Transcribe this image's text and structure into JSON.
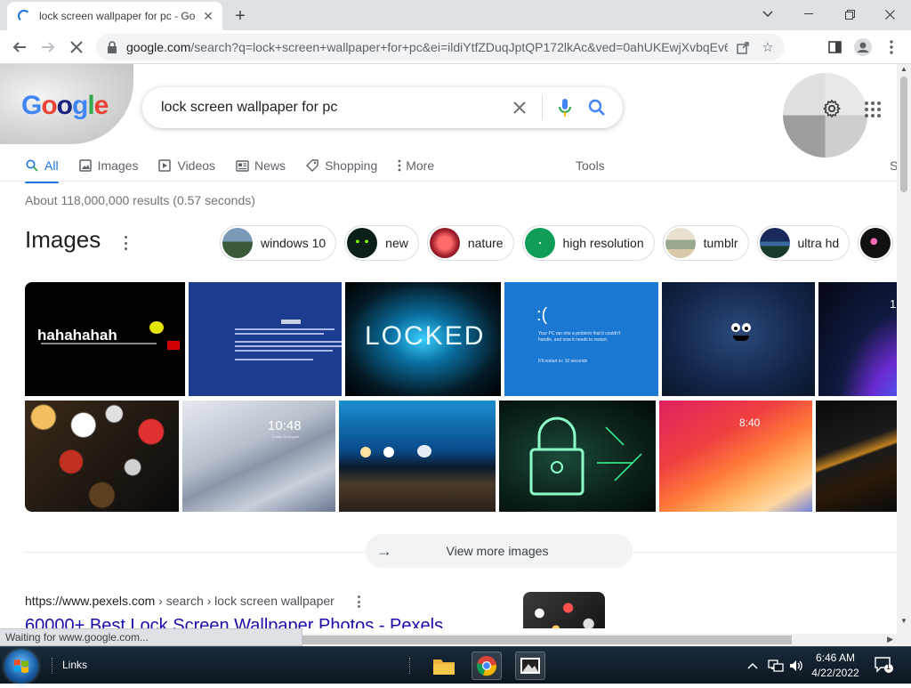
{
  "browser": {
    "tab_title": "lock screen wallpaper for pc - Go",
    "url_host": "google.com",
    "url_rest": "/search?q=lock+screen+wallpaper+for+pc&ei=ildiYtfZDuqJptQP172lkAc&ved=0ahUKEwjXvbqEv6f3...",
    "status_text": "Waiting for www.google.com..."
  },
  "google": {
    "logo_text": "Google",
    "query": "lock screen wallpaper for pc",
    "tabs": [
      {
        "label": "All",
        "icon": "search-icon",
        "active": true
      },
      {
        "label": "Images",
        "icon": "image-icon"
      },
      {
        "label": "Videos",
        "icon": "play-icon"
      },
      {
        "label": "News",
        "icon": "news-icon"
      },
      {
        "label": "Shopping",
        "icon": "tag-icon"
      },
      {
        "label": "More",
        "icon": "more-vert-icon"
      }
    ],
    "tools_label": "Tools",
    "clipped_tab": "S",
    "result_stats": "About 118,000,000 results (0.57 seconds)",
    "images_heading": "Images",
    "chips": [
      {
        "label": "windows 10",
        "color": "#4a6b8a"
      },
      {
        "label": "new",
        "color": "#0d1f1a"
      },
      {
        "label": "nature",
        "color": "#c0303a"
      },
      {
        "label": "high resolution",
        "color": "#0f9d58"
      },
      {
        "label": "tumblr",
        "color": "#d9c9a8"
      },
      {
        "label": "ultra hd",
        "color": "#2a4a7a"
      },
      {
        "label": "",
        "color": "#1a1a1a"
      }
    ],
    "image_texts": {
      "hahaha": "hahahahah",
      "locked": "LOCKED",
      "sad_face": ":(",
      "bsod_line1": "Your PC ran into a problem that it couldn't",
      "bsod_line2": "handle, and now it needs to restart.",
      "bsod_line3": "It'll restart in: 10 seconds",
      "time1": "10:48",
      "date1": "Friday 28 August",
      "time2": "8:40",
      "clipped_digit": "1"
    },
    "view_more_label": "View more images",
    "result": {
      "cite_host": "https://www.pexels.com",
      "cite_path": " › search › lock screen wallpaper",
      "title": "60000+ Best Lock Screen Wallpaper Photos - Pexels"
    }
  },
  "taskbar": {
    "links_label": "Links",
    "time": "6:46 AM",
    "date": "4/22/2022",
    "notification_count": "1"
  },
  "colors": {
    "accent": "#1a73e8",
    "link": "#1a0dab",
    "taskbar_bg": "#0c1620"
  }
}
